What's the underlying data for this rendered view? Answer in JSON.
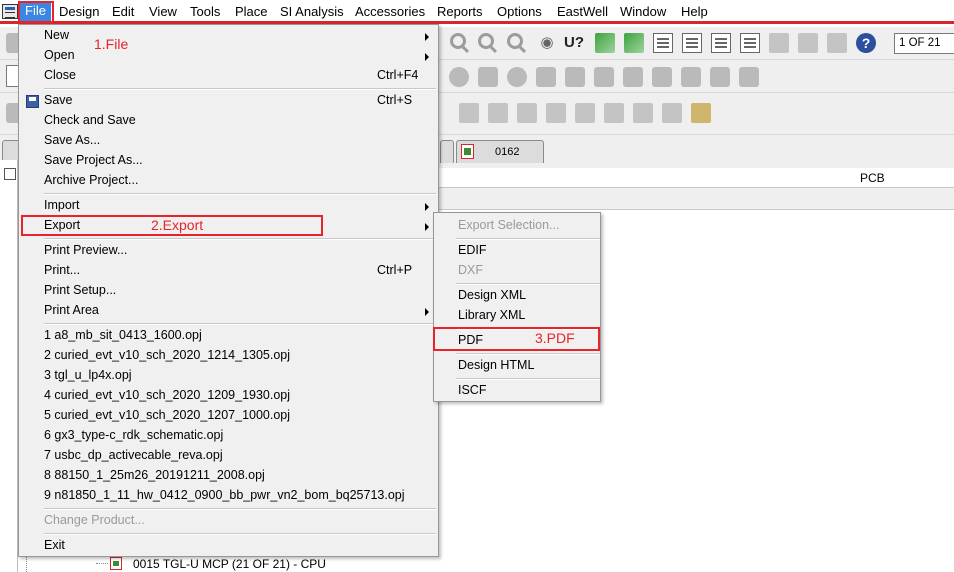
{
  "menubar": {
    "items": [
      "File",
      "Design",
      "Edit",
      "View",
      "Tools",
      "Place",
      "SI Analysis",
      "Accessories",
      "Reports",
      "Options",
      "EastWell",
      "Window",
      "Help"
    ]
  },
  "toolbar": {
    "page_counter": "1 OF 21"
  },
  "tabs": {
    "doc_tab_label": "0162"
  },
  "pane": {
    "column_header": "PCB"
  },
  "tree": {
    "item_label": "0015 TGL-U MCP (21 OF 21) - CPU"
  },
  "file_menu": {
    "new": "New",
    "open": "Open",
    "close": "Close",
    "close_shortcut": "Ctrl+F4",
    "save": "Save",
    "save_shortcut": "Ctrl+S",
    "check_and_save": "Check and Save",
    "save_as": "Save As...",
    "save_project_as": "Save Project As...",
    "archive_project": "Archive Project...",
    "import": "Import",
    "export": "Export",
    "print_preview": "Print Preview...",
    "print": "Print...",
    "print_shortcut": "Ctrl+P",
    "print_setup": "Print Setup...",
    "print_area": "Print Area",
    "recent": [
      "1 a8_mb_sit_0413_1600.opj",
      "2 curied_evt_v10_sch_2020_1214_1305.opj",
      "3 tgl_u_lp4x.opj",
      "4 curied_evt_v10_sch_2020_1209_1930.opj",
      "5 curied_evt_v10_sch_2020_1207_1000.opj",
      "6 gx3_type-c_rdk_schematic.opj",
      "7 usbc_dp_activecable_reva.opj",
      "8 88150_1_25m26_20191211_2008.opj",
      "9 n81850_1_11_hw_0412_0900_bb_pwr_vn2_bom_bq25713.opj"
    ],
    "change_product": "Change Product...",
    "exit": "Exit"
  },
  "export_menu": {
    "export_selection": "Export Selection...",
    "edif": "EDIF",
    "dxf": "DXF",
    "design_xml": "Design XML",
    "library_xml": "Library XML",
    "pdf": "PDF",
    "design_html": "Design HTML",
    "iscf": "ISCF"
  },
  "annotations": {
    "step1": "1.File",
    "step2": "2.Export",
    "step3": "3.PDF"
  },
  "colors": {
    "accent_red": "#e8232a",
    "menu_highlight": "#3b86e0",
    "menu_bg": "#f0f0f0"
  }
}
